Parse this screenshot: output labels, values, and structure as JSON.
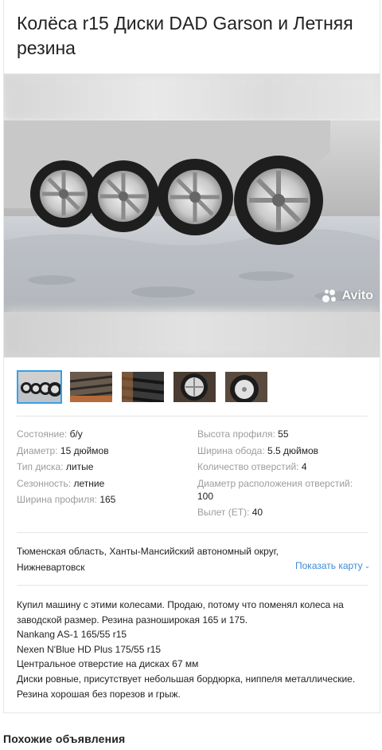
{
  "listing": {
    "title": "Колёса r15 Диски DAD Garson и Летняя резина",
    "watermark": "Avito"
  },
  "thumbnails": [
    {
      "name": "wheels-on-snow",
      "active": true
    },
    {
      "name": "tire-tread-1",
      "active": false
    },
    {
      "name": "tire-tread-2",
      "active": false
    },
    {
      "name": "rim-closeup",
      "active": false
    },
    {
      "name": "rim-on-tire",
      "active": false
    }
  ],
  "params": {
    "left": [
      {
        "key": "Состояние:",
        "value": "б/у"
      },
      {
        "key": "Диаметр:",
        "value": "15 дюймов"
      },
      {
        "key": "Тип диска:",
        "value": "литые"
      },
      {
        "key": "Сезонность:",
        "value": "летние"
      },
      {
        "key": "Ширина профиля:",
        "value": "165"
      }
    ],
    "right": [
      {
        "key": "Высота профиля:",
        "value": "55"
      },
      {
        "key": "Ширина обода:",
        "value": "5.5 дюймов"
      },
      {
        "key": "Количество отверстий:",
        "value": "4"
      },
      {
        "key": "Диаметр расположения отверстий:",
        "value": "100"
      },
      {
        "key": "Вылет (ET):",
        "value": "40"
      }
    ]
  },
  "location": {
    "address": "Тюменская область, Ханты-Мансийский автономный округ, Нижневартовск",
    "map_link": "Показать карту"
  },
  "description": [
    "Купил машину с этими колесами. Продаю, потому что поменял колеса на заводской размер. Резина разноширокая 165 и 175.",
    "Nankang AS-1 165/55 r15",
    "Nexen N'Blue HD Plus 175/55 r15",
    "Центральное отверстие на дисках 67 мм",
    "Диски ровные, присутствует небольшая бордюрка, ниппеля металлические. Резина хорошая без порезов и грыж."
  ],
  "similar": {
    "heading": "Похожие объявления"
  },
  "colors": {
    "link": "#3e8bd6",
    "active_thumb": "#37a0e8",
    "muted": "#9c9c9c"
  }
}
